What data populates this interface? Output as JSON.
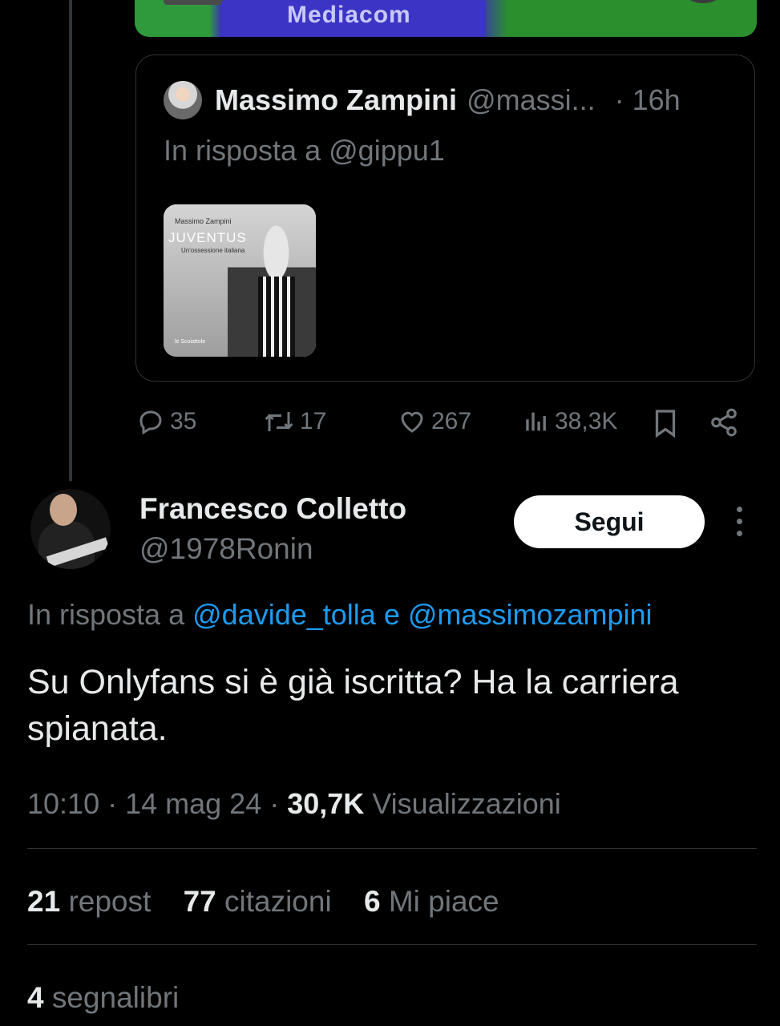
{
  "quoted_tweet": {
    "media_label": "Mediacom",
    "author_name": "Massimo Zampini",
    "author_handle": "@massi...",
    "time": "· 16h",
    "reply_prefix": "In risposta a",
    "reply_to": "@gippu1",
    "book": {
      "author": "Massimo Zampini",
      "title": "JUVENTUS",
      "subtitle": "Un'ossessione italiana",
      "publisher": "le Scoiattole"
    },
    "actions": {
      "replies": "35",
      "reposts": "17",
      "likes": "267",
      "views": "38,3K"
    }
  },
  "tweet": {
    "author_name": "Francesco Colletto",
    "author_handle": "@1978Ronin",
    "follow_label": "Segui",
    "reply_prefix": "In risposta a",
    "mention_1": "@davide_tolla",
    "conjunction": "e",
    "mention_2": "@massimozampini",
    "text": "Su Onlyfans si è già iscritta? Ha la carriera spianata.",
    "time": "10:10",
    "date": "14 mag 24",
    "views_count": "30,7K",
    "views_label": "Visualizzazioni",
    "stats": {
      "reposts_count": "21",
      "reposts_label": "repost",
      "quotes_count": "77",
      "quotes_label": "citazioni",
      "likes_count": "6",
      "likes_label": "Mi piace",
      "bookmarks_count": "4",
      "bookmarks_label": "segnalibri"
    }
  },
  "colors": {
    "background": "#000000",
    "text_primary": "#e7e9ea",
    "text_secondary": "#71767b",
    "link": "#1d9bf0",
    "border": "#2f3336"
  }
}
